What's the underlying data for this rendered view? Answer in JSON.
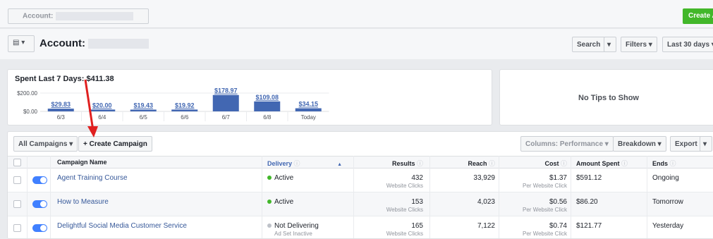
{
  "topbar": {
    "account_label": "Account:",
    "create_label": "Create A"
  },
  "header": {
    "menu_icon": "▤ ▾",
    "title": "Account:",
    "search_label": "Search",
    "filters_label": "Filters ▾",
    "date_label": "Last 30 days ▾",
    "search_caret": "▾",
    "date_caret": "▾"
  },
  "spend": {
    "title": "Spent Last 7 Days: $411.38",
    "bar_color": "#4267b2"
  },
  "chart_data": {
    "type": "bar",
    "categories": [
      "6/3",
      "6/4",
      "6/5",
      "6/6",
      "6/7",
      "6/8",
      "Today"
    ],
    "values": [
      29.83,
      20.0,
      19.43,
      19.92,
      178.97,
      109.08,
      34.15
    ],
    "value_labels": [
      "$29.83",
      "$20.00",
      "$19.43",
      "$19.92",
      "$178.97",
      "$109.08",
      "$34.15"
    ],
    "ytick_labels": [
      "$200.00",
      "$0.00"
    ],
    "ylim": [
      0,
      200
    ]
  },
  "tips": {
    "text": "No Tips to Show"
  },
  "toolbar": {
    "all_campaigns": "All Campaigns ▾",
    "create_campaign": "+ Create Campaign",
    "columns": "Columns: Performance ▾",
    "breakdown": "Breakdown ▾",
    "export": "Export",
    "export_caret": "▾"
  },
  "table": {
    "headers": {
      "name": "Campaign Name",
      "delivery": "Delivery",
      "results": "Results",
      "reach": "Reach",
      "cost": "Cost",
      "spent": "Amount Spent",
      "ends": "Ends"
    },
    "info_glyph": "ⓘ",
    "sort_glyph": "▲",
    "rows": [
      {
        "name": "Agent Training Course",
        "delivery": "Active",
        "delivery_sub": "",
        "results": "432",
        "results_sub": "Website Clicks",
        "reach": "33,929",
        "cost": "$1.37",
        "cost_sub": "Per Website Click",
        "spent": "$591.12",
        "ends": "Ongoing"
      },
      {
        "name": "How to Measure",
        "delivery": "Active",
        "delivery_sub": "",
        "results": "153",
        "results_sub": "Website Clicks",
        "reach": "4,023",
        "cost": "$0.56",
        "cost_sub": "Per Website Click",
        "spent": "$86.20",
        "ends": "Tomorrow"
      },
      {
        "name": "Delightful Social Media Customer Service",
        "delivery": "Not Delivering",
        "delivery_sub": "Ad Set Inactive",
        "results": "165",
        "results_sub": "Website Clicks",
        "reach": "7,122",
        "cost": "$0.74",
        "cost_sub": "Per Website Click",
        "spent": "$121.77",
        "ends": "Yesterday"
      }
    ],
    "status_colors": {
      "active": "#42b72a",
      "inactive": "#bec2c9"
    }
  },
  "annotation": {
    "arrow_color": "#e02020"
  }
}
